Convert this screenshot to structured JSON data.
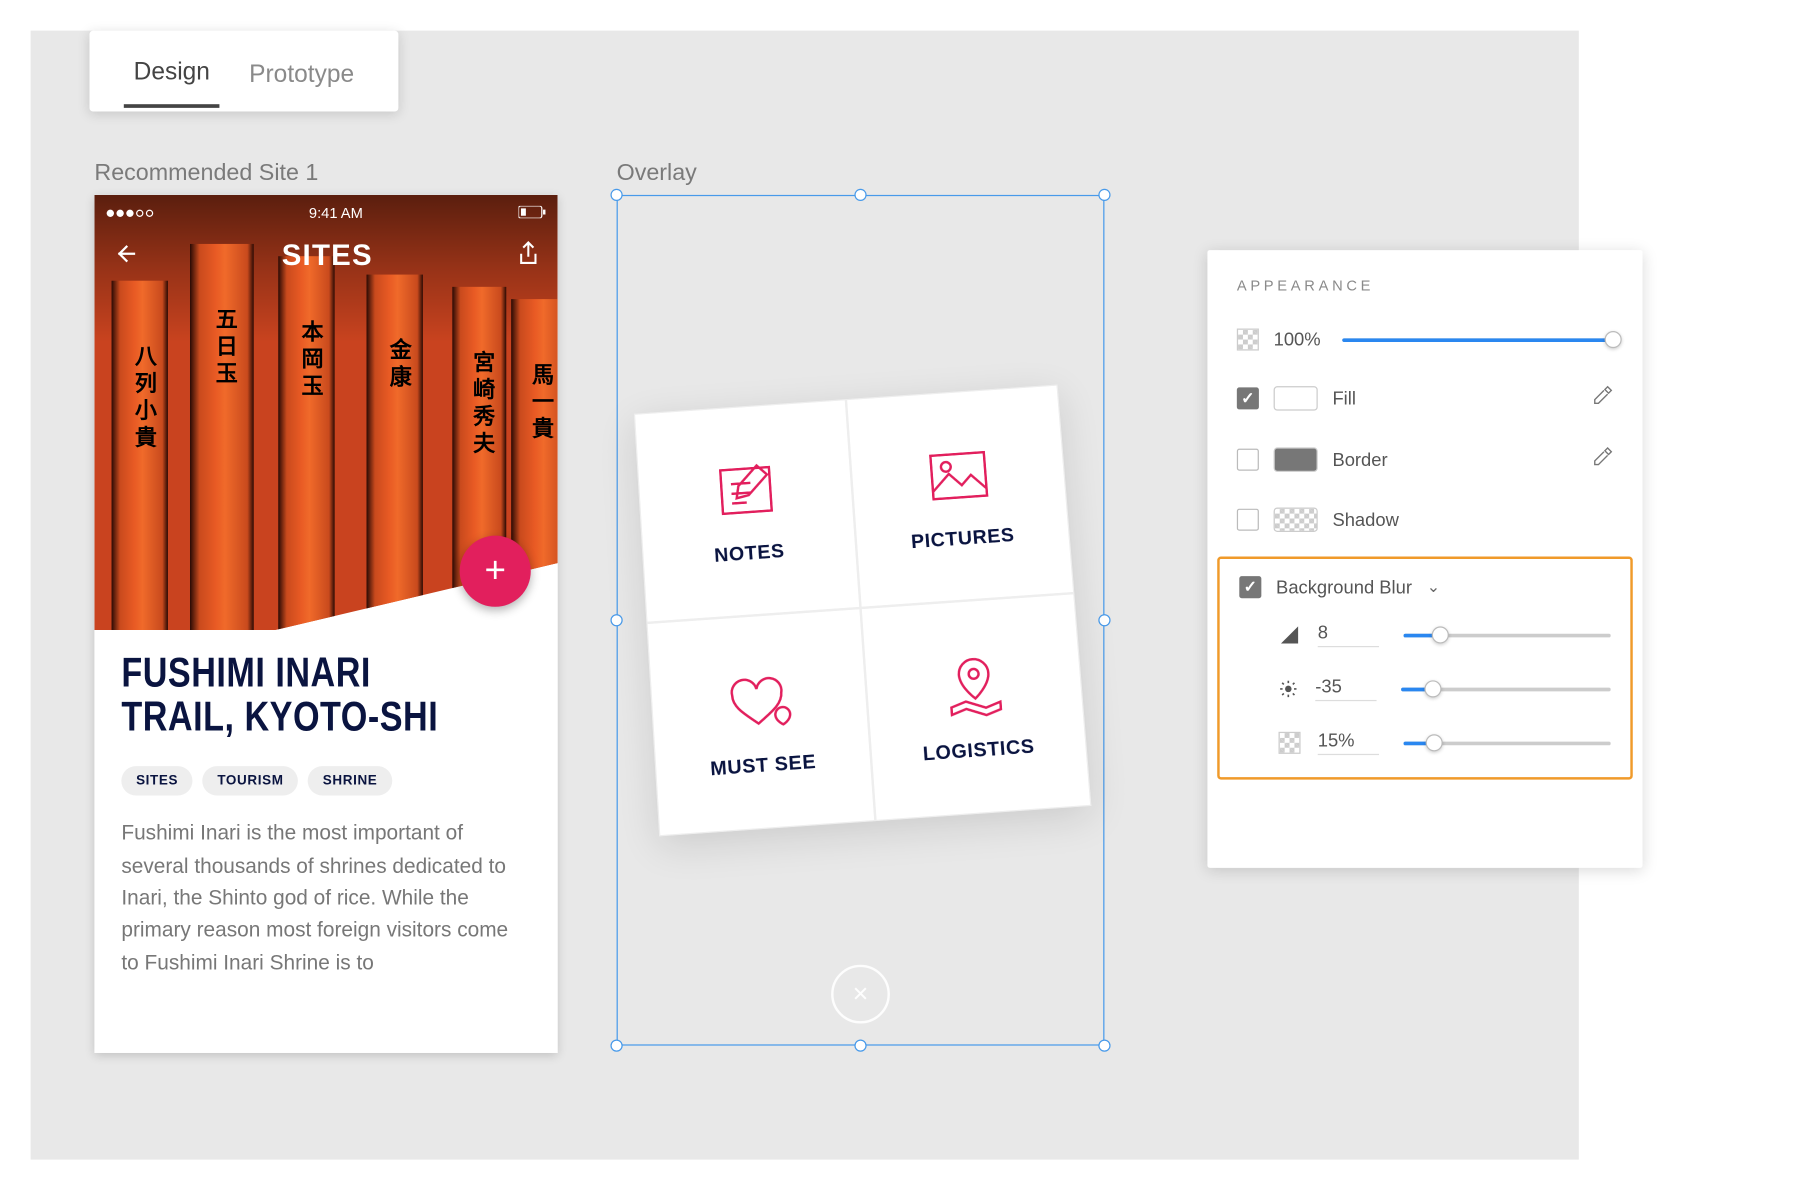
{
  "tabs": {
    "design": "Design",
    "prototype": "Prototype"
  },
  "artboards": {
    "recommended": {
      "label": "Recommended Site 1"
    },
    "overlay": {
      "label": "Overlay"
    }
  },
  "phone": {
    "status": {
      "time": "9:41 AM"
    },
    "nav_title": "SITES",
    "fab": "+",
    "title": "FUSHIMI INARI TRAIL, KYOTO-SHI",
    "tags": [
      "SITES",
      "TOURISM",
      "SHRINE"
    ],
    "body": "Fushimi Inari is the most important of several thousands of shrines dedicated to Inari, the Shinto god of rice. While the primary reason most foreign visitors come to Fushimi Inari Shrine is to"
  },
  "overlay_card": {
    "notes": "NOTES",
    "pictures": "PICTURES",
    "mustsee": "MUST SEE",
    "logistics": "LOGISTICS",
    "close": "×"
  },
  "panel": {
    "title": "APPEARANCE",
    "opacity": "100%",
    "fill": "Fill",
    "border": "Border",
    "shadow": "Shadow",
    "bgblur": {
      "label": "Background Blur",
      "amount": "8",
      "brightness": "-35",
      "noise": "15%"
    }
  }
}
